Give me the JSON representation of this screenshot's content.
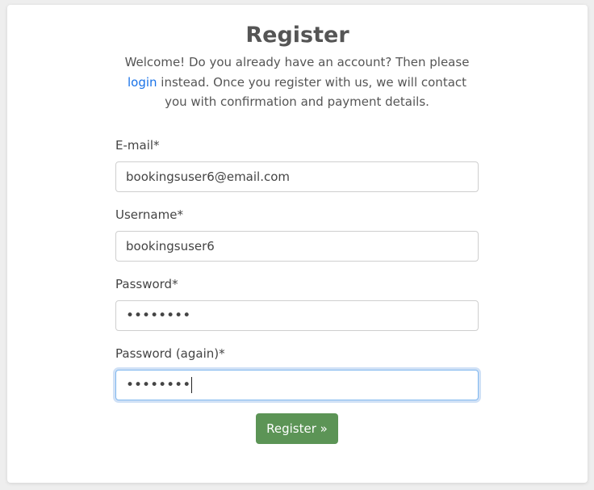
{
  "register": {
    "title": "Register",
    "intro_before_link": "Welcome! Do you already have an account? Then please ",
    "login_link": "login",
    "intro_after_link": " instead. Once you register with us, we will contact you with confirmation and payment details."
  },
  "form": {
    "email": {
      "label": "E-mail*",
      "value": "bookingsuser6@email.com"
    },
    "username": {
      "label": "Username*",
      "value": "bookingsuser6"
    },
    "password": {
      "label": "Password*",
      "value": "••••••••"
    },
    "password_again": {
      "label": "Password (again)*",
      "value": "••••••••"
    },
    "submit_label": "Register »"
  }
}
